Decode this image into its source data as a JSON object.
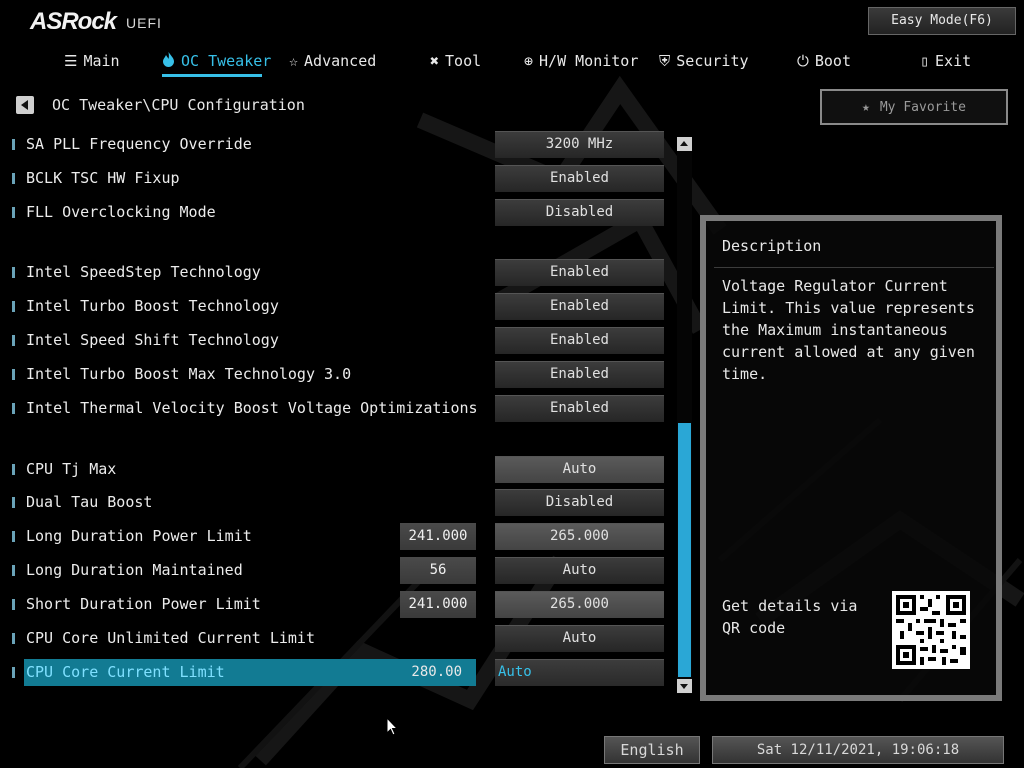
{
  "header": {
    "logo": "ASRock",
    "logo_suffix": "UEFI",
    "easy_mode_button": "Easy Mode(F6)"
  },
  "tabs": [
    {
      "label": "Main",
      "icon": "list-icon",
      "active": false
    },
    {
      "label": "OC Tweaker",
      "icon": "flame-icon",
      "active": true
    },
    {
      "label": "Advanced",
      "icon": "star-tool-icon",
      "active": false
    },
    {
      "label": "Tool",
      "icon": "wrench-icon",
      "active": false
    },
    {
      "label": "H/W Monitor",
      "icon": "globe-icon",
      "active": false
    },
    {
      "label": "Security",
      "icon": "shield-icon",
      "active": false
    },
    {
      "label": "Boot",
      "icon": "power-icon",
      "active": false
    },
    {
      "label": "Exit",
      "icon": "exit-door-icon",
      "active": false
    }
  ],
  "breadcrumb": "OC Tweaker\\CPU Configuration",
  "favorite_button": "My Favorite",
  "settings": [
    {
      "label": "SA PLL Frequency Override",
      "value": "3200 MHz"
    },
    {
      "label": "BCLK TSC HW Fixup",
      "value": "Enabled"
    },
    {
      "label": "FLL Overclocking Mode",
      "value": "Disabled"
    },
    {
      "label": "Intel SpeedStep Technology",
      "value": "Enabled"
    },
    {
      "label": "Intel Turbo Boost Technology",
      "value": "Enabled"
    },
    {
      "label": "Intel Speed Shift Technology",
      "value": "Enabled"
    },
    {
      "label": "Intel Turbo Boost Max Technology 3.0",
      "value": "Enabled"
    },
    {
      "label": "Intel Thermal Velocity Boost Voltage Optimizations",
      "value": "Enabled"
    },
    {
      "label": "CPU Tj Max",
      "value": "Auto"
    },
    {
      "label": "Dual Tau Boost",
      "value": "Disabled"
    },
    {
      "label": "Long Duration Power Limit",
      "current": "241.000",
      "value": "265.000"
    },
    {
      "label": "Long Duration Maintained",
      "current": "56",
      "value": "Auto"
    },
    {
      "label": "Short Duration Power Limit",
      "current": "241.000",
      "value": "265.000"
    },
    {
      "label": "CPU Core Unlimited Current Limit",
      "value": "Auto"
    },
    {
      "label": "CPU Core Current Limit",
      "current": "280.00",
      "value": "Auto",
      "selected": true
    }
  ],
  "description": {
    "title": "Description",
    "text": "Voltage Regulator Current Limit. This value represents the Maximum instantaneous current allowed at any given time.",
    "qr_text": "Get details via QR code"
  },
  "footer": {
    "language": "English",
    "datetime": "Sat 12/11/2021, 19:06:18"
  }
}
